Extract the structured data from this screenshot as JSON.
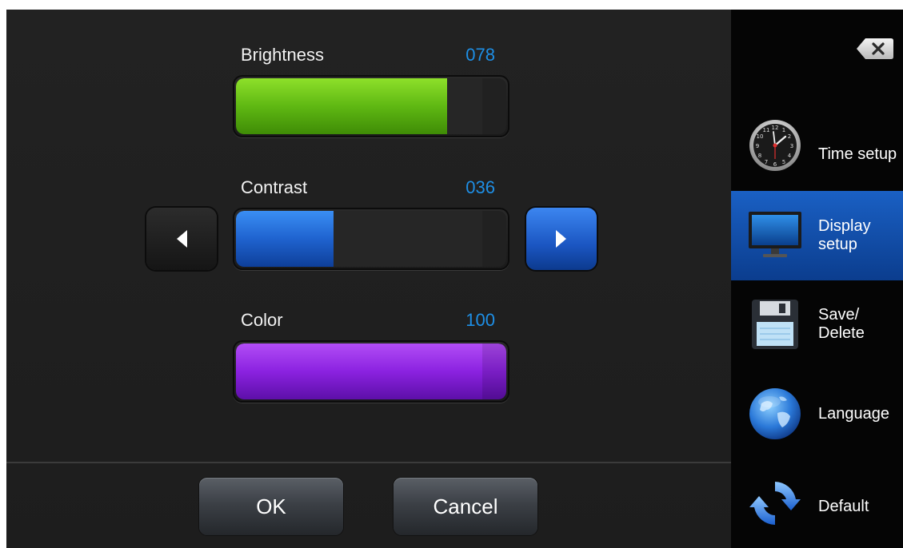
{
  "sliders": {
    "brightness": {
      "label": "Brightness",
      "value_text": "078",
      "level": 0.78,
      "color": "#5fb813"
    },
    "contrast": {
      "label": "Contrast",
      "value_text": "036",
      "level": 0.36,
      "color": "#1f63cf"
    },
    "color": {
      "label": "Color",
      "value_text": "100",
      "level": 1.0,
      "color": "#8b22e0"
    }
  },
  "footer": {
    "ok_label": "OK",
    "cancel_label": "Cancel"
  },
  "sidebar": {
    "close_icon": "backspace-close-icon",
    "items": [
      {
        "label": "Time setup",
        "icon": "clock-icon",
        "selected": false
      },
      {
        "label": "Display\nsetup",
        "icon": "monitor-icon",
        "selected": true
      },
      {
        "label": "Save/\nDelete",
        "icon": "floppy-disk-icon",
        "selected": false
      },
      {
        "label": "Language",
        "icon": "globe-icon",
        "selected": false
      },
      {
        "label": "Default",
        "icon": "refresh-icon",
        "selected": false
      }
    ]
  },
  "colors": {
    "accent_blue": "#1a60c4",
    "value_text": "#1e8fe6"
  }
}
